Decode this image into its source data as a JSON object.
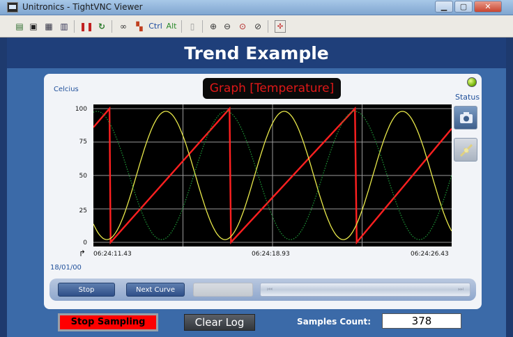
{
  "window": {
    "title": "Unitronics - TightVNC Viewer"
  },
  "toolbar": {
    "ctrl_label": "Ctrl",
    "alt_label": "Alt"
  },
  "hmi": {
    "title": "Trend Example",
    "graph_title": "Graph [Temperature]",
    "unit_label": "Celcius",
    "status_label": "Status",
    "date_label": "18/01/00",
    "y_ticks": [
      "100",
      "75",
      "50",
      "25",
      "0"
    ],
    "x_ticks": [
      "06:24:11.43",
      "06:24:18.93",
      "06:24:26.43"
    ],
    "buttons": {
      "stop": "Stop",
      "next_curve": "Next Curve"
    },
    "footer": {
      "stop_sampling": "Stop Sampling",
      "clear_log": "Clear Log",
      "samples_label": "Samples Count:",
      "samples_value": "378"
    }
  },
  "colors": {
    "status_led": "#7ab810",
    "stop_sampling_bg": "#ff0000",
    "graph_title_text": "#e01818"
  },
  "chart_data": {
    "type": "line",
    "title": "Graph [Temperature]",
    "ylabel": "Celcius",
    "ylim": [
      0,
      100
    ],
    "x_ticks": [
      "06:24:11.43",
      "06:24:18.93",
      "06:24:26.43"
    ],
    "grid": true,
    "series": [
      {
        "color": "#ff2020",
        "style": "solid",
        "shape": "sawtooth",
        "points": [
          [
            0,
            86
          ],
          [
            0.045,
            100
          ],
          [
            0.048,
            0
          ],
          [
            0.38,
            100
          ],
          [
            0.384,
            0
          ],
          [
            0.73,
            100
          ],
          [
            0.735,
            0
          ],
          [
            1.0,
            85
          ]
        ]
      },
      {
        "color": "#e8e84a",
        "style": "solid",
        "shape": "sine",
        "period": 0.33,
        "phase": 0.12,
        "mid": 50,
        "amp": 48
      },
      {
        "color": "#1f9e3a",
        "style": "dotted",
        "shape": "sine",
        "period": 0.36,
        "phase": 0.28,
        "mid": 50,
        "amp": 48
      }
    ]
  }
}
